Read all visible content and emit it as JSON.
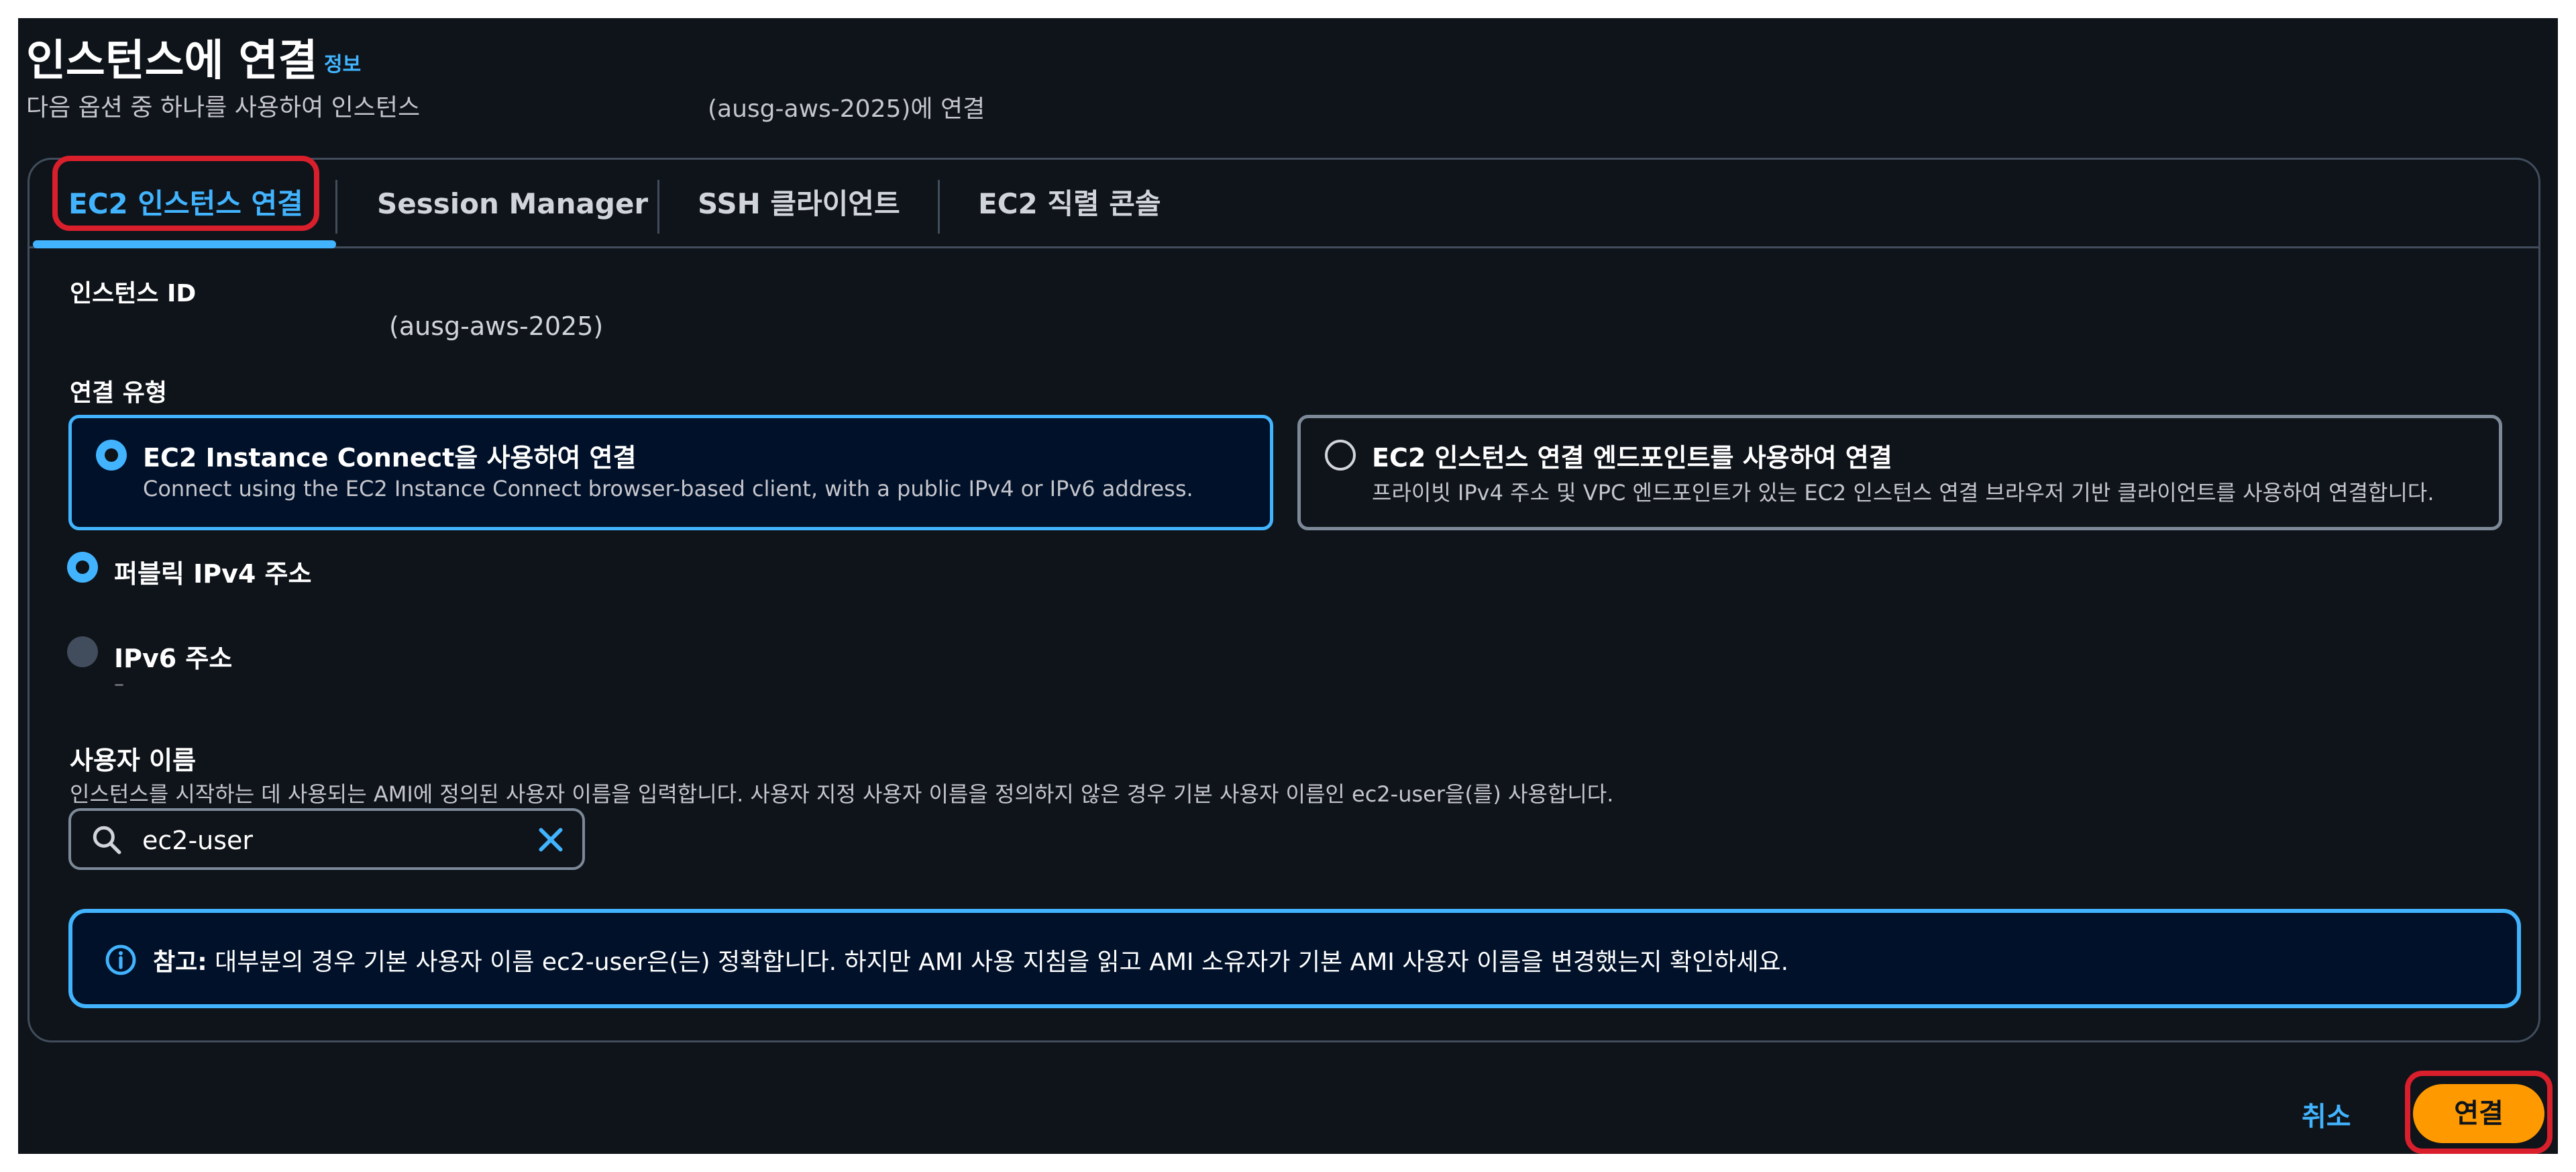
{
  "header": {
    "title": "인스턴스에 연결",
    "info_link": "정보",
    "subtitle": "다음 옵션 중 하나를 사용하여 인스턴스",
    "subtitle_suffix": "(ausg-aws-2025)에 연결"
  },
  "tabs": [
    {
      "label": "EC2 인스턴스 연결",
      "active": true
    },
    {
      "label": "Session Manager",
      "active": false
    },
    {
      "label": "SSH 클라이언트",
      "active": false
    },
    {
      "label": "EC2 직렬 콘솔",
      "active": false
    }
  ],
  "instance": {
    "label": "인스턴스 ID",
    "value": "(ausg-aws-2025)"
  },
  "connection_type": {
    "label": "연결 유형",
    "options": [
      {
        "title": "EC2 Instance Connect을 사용하여 연결",
        "description": "Connect using the EC2 Instance Connect browser-based client, with a public IPv4 or IPv6 address.",
        "selected": true
      },
      {
        "title": "EC2 인스턴스 연결 엔드포인트를 사용하여 연결",
        "description": "프라이빗 IPv4 주소 및 VPC 엔드포인트가 있는 EC2 인스턴스 연결 브라우저 기반 클라이언트를 사용하여 연결합니다.",
        "selected": false
      }
    ]
  },
  "address_options": [
    {
      "label": "퍼블릭 IPv4 주소",
      "selected": true,
      "value": ""
    },
    {
      "label": "IPv6 주소",
      "selected": false,
      "disabled": true,
      "value": "–"
    }
  ],
  "username": {
    "label": "사용자 이름",
    "description": "인스턴스를 시작하는 데 사용되는 AMI에 정의된 사용자 이름을 입력합니다. 사용자 지정 사용자 이름을 정의하지 않은 경우 기본 사용자 이름인 ec2-user을(를) 사용합니다.",
    "value": "ec2-user"
  },
  "note": {
    "label": "참고:",
    "text": "대부분의 경우 기본 사용자 이름 ec2-user은(는) 정확합니다. 하지만 AMI 사용 지침을 읽고 AMI 소유자가 기본 AMI 사용자 이름을 변경했는지 확인하세요."
  },
  "footer": {
    "cancel_label": "취소",
    "connect_label": "연결"
  },
  "colors": {
    "background": "#0f141a",
    "accent": "#42b4ff",
    "primary_button": "#ff9900",
    "highlight": "#d91f2c"
  }
}
